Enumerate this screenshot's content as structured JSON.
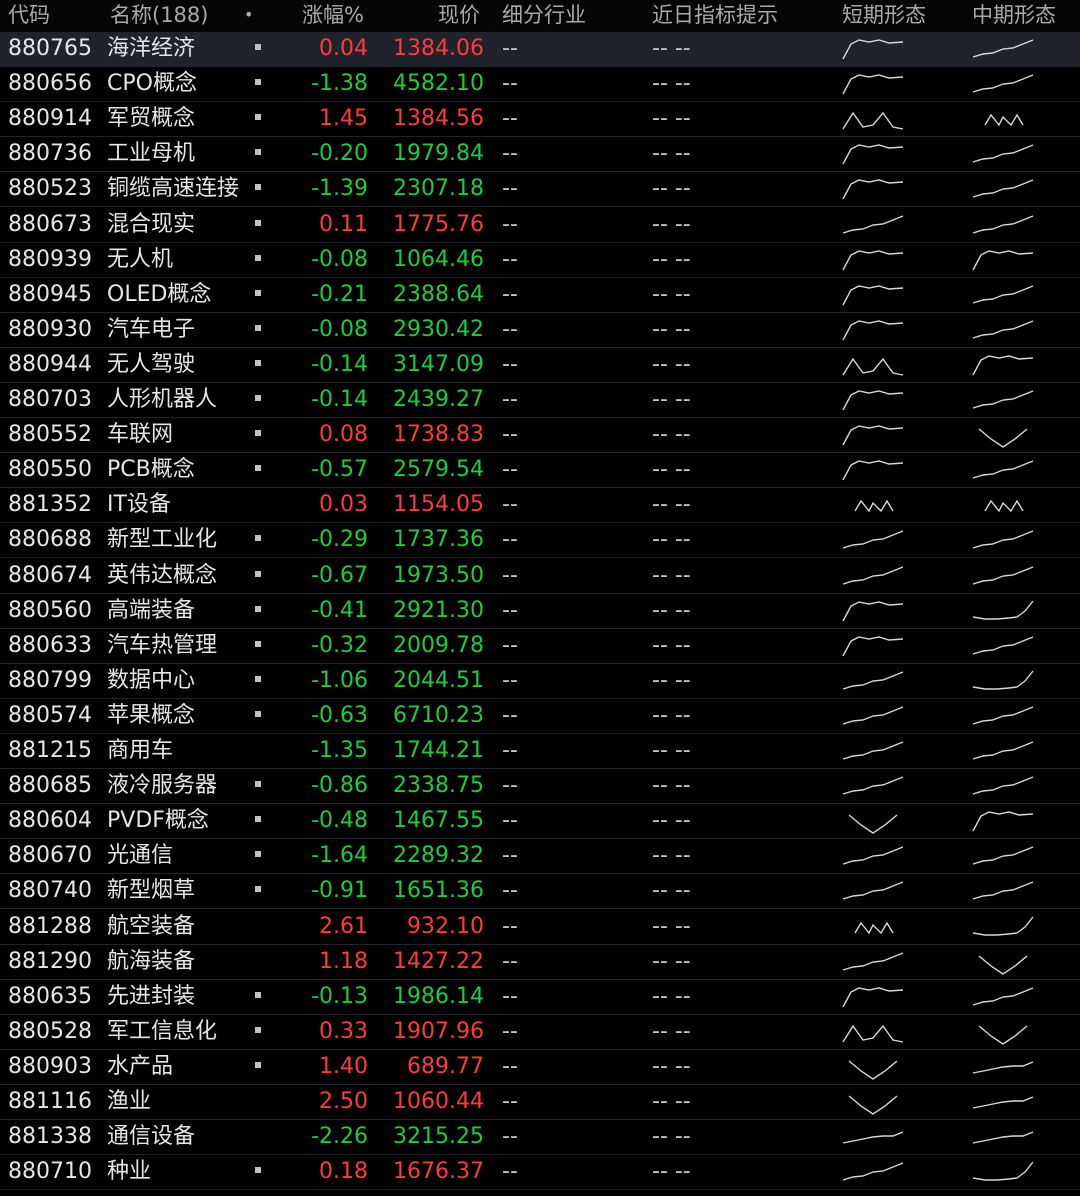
{
  "columns": {
    "code": "代码",
    "name": "名称(188)",
    "marker": "•",
    "change": "涨幅%",
    "price": "现价",
    "industry": "细分行业",
    "hint": "近日指标提示",
    "short_shape": "短期形态",
    "mid_shape": "中期形态"
  },
  "colors": {
    "up": "#ff3b3b",
    "down": "#1ccd3c",
    "selected_row": "#20232b"
  },
  "rows": [
    {
      "code": "880765",
      "name": "海洋经济",
      "dot": true,
      "chg": "0.04",
      "price": "1384.06",
      "industry": "--",
      "hint": "-- --",
      "short": "peak",
      "mid": "rise"
    },
    {
      "code": "880656",
      "name": "CPO概念",
      "dot": true,
      "chg": "-1.38",
      "price": "4582.10",
      "industry": "--",
      "hint": "-- --",
      "short": "peak",
      "mid": "rise"
    },
    {
      "code": "880914",
      "name": "军贸概念",
      "dot": true,
      "chg": "1.45",
      "price": "1384.56",
      "industry": "--",
      "hint": "-- --",
      "short": "m",
      "mid": "na"
    },
    {
      "code": "880736",
      "name": "工业母机",
      "dot": true,
      "chg": "-0.20",
      "price": "1979.84",
      "industry": "--",
      "hint": "-- --",
      "short": "peak",
      "mid": "rise"
    },
    {
      "code": "880523",
      "name": "铜缆高速连接",
      "dot": true,
      "chg": "-1.39",
      "price": "2307.18",
      "industry": "--",
      "hint": "-- --",
      "short": "peak",
      "mid": "rise"
    },
    {
      "code": "880673",
      "name": "混合现实",
      "dot": true,
      "chg": "0.11",
      "price": "1775.76",
      "industry": "--",
      "hint": "-- --",
      "short": "rise",
      "mid": "rise"
    },
    {
      "code": "880939",
      "name": "无人机",
      "dot": true,
      "chg": "-0.08",
      "price": "1064.46",
      "industry": "--",
      "hint": "-- --",
      "short": "peak",
      "mid": "peak"
    },
    {
      "code": "880945",
      "name": "OLED概念",
      "dot": true,
      "chg": "-0.21",
      "price": "2388.64",
      "industry": "--",
      "hint": "-- --",
      "short": "peak",
      "mid": "rise"
    },
    {
      "code": "880930",
      "name": "汽车电子",
      "dot": true,
      "chg": "-0.08",
      "price": "2930.42",
      "industry": "--",
      "hint": "-- --",
      "short": "peak",
      "mid": "rise"
    },
    {
      "code": "880944",
      "name": "无人驾驶",
      "dot": true,
      "chg": "-0.14",
      "price": "3147.09",
      "industry": "--",
      "hint": "-- --",
      "short": "m",
      "mid": "peak"
    },
    {
      "code": "880703",
      "name": "人形机器人",
      "dot": true,
      "chg": "-0.14",
      "price": "2439.27",
      "industry": "--",
      "hint": "-- --",
      "short": "peak",
      "mid": "rise"
    },
    {
      "code": "880552",
      "name": "车联网",
      "dot": true,
      "chg": "0.08",
      "price": "1738.83",
      "industry": "--",
      "hint": "-- --",
      "short": "peak",
      "mid": "v"
    },
    {
      "code": "880550",
      "name": "PCB概念",
      "dot": true,
      "chg": "-0.57",
      "price": "2579.54",
      "industry": "--",
      "hint": "-- --",
      "short": "peak",
      "mid": "rise"
    },
    {
      "code": "881352",
      "name": "IT设备",
      "dot": false,
      "chg": "0.03",
      "price": "1154.05",
      "industry": "--",
      "hint": "-- --",
      "short": "na",
      "mid": "na"
    },
    {
      "code": "880688",
      "name": "新型工业化",
      "dot": true,
      "chg": "-0.29",
      "price": "1737.36",
      "industry": "--",
      "hint": "-- --",
      "short": "rise",
      "mid": "rise"
    },
    {
      "code": "880674",
      "name": "英伟达概念",
      "dot": true,
      "chg": "-0.67",
      "price": "1973.50",
      "industry": "--",
      "hint": "-- --",
      "short": "rise",
      "mid": "rise"
    },
    {
      "code": "880560",
      "name": "高端装备",
      "dot": true,
      "chg": "-0.41",
      "price": "2921.30",
      "industry": "--",
      "hint": "-- --",
      "short": "peak",
      "mid": "hook"
    },
    {
      "code": "880633",
      "name": "汽车热管理",
      "dot": true,
      "chg": "-0.32",
      "price": "2009.78",
      "industry": "--",
      "hint": "-- --",
      "short": "peak",
      "mid": "rise"
    },
    {
      "code": "880799",
      "name": "数据中心",
      "dot": true,
      "chg": "-1.06",
      "price": "2044.51",
      "industry": "--",
      "hint": "-- --",
      "short": "rise",
      "mid": "hook"
    },
    {
      "code": "880574",
      "name": "苹果概念",
      "dot": true,
      "chg": "-0.63",
      "price": "6710.23",
      "industry": "--",
      "hint": "-- --",
      "short": "rise",
      "mid": "rise"
    },
    {
      "code": "881215",
      "name": "商用车",
      "dot": false,
      "chg": "-1.35",
      "price": "1744.21",
      "industry": "--",
      "hint": "-- --",
      "short": "rise",
      "mid": "rise"
    },
    {
      "code": "880685",
      "name": "液冷服务器",
      "dot": true,
      "chg": "-0.86",
      "price": "2338.75",
      "industry": "--",
      "hint": "-- --",
      "short": "rise",
      "mid": "rise"
    },
    {
      "code": "880604",
      "name": "PVDF概念",
      "dot": true,
      "chg": "-0.48",
      "price": "1467.55",
      "industry": "--",
      "hint": "-- --",
      "short": "v",
      "mid": "peak"
    },
    {
      "code": "880670",
      "name": "光通信",
      "dot": true,
      "chg": "-1.64",
      "price": "2289.32",
      "industry": "--",
      "hint": "-- --",
      "short": "rise",
      "mid": "rise"
    },
    {
      "code": "880740",
      "name": "新型烟草",
      "dot": true,
      "chg": "-0.91",
      "price": "1651.36",
      "industry": "--",
      "hint": "-- --",
      "short": "rise",
      "mid": "rise"
    },
    {
      "code": "881288",
      "name": "航空装备",
      "dot": false,
      "chg": "2.61",
      "price": "932.10",
      "industry": "--",
      "hint": "-- --",
      "short": "na",
      "mid": "hook"
    },
    {
      "code": "881290",
      "name": "航海装备",
      "dot": false,
      "chg": "1.18",
      "price": "1427.22",
      "industry": "--",
      "hint": "-- --",
      "short": "rise",
      "mid": "v"
    },
    {
      "code": "880635",
      "name": "先进封装",
      "dot": true,
      "chg": "-0.13",
      "price": "1986.14",
      "industry": "--",
      "hint": "-- --",
      "short": "peak",
      "mid": "rise"
    },
    {
      "code": "880528",
      "name": "军工信息化",
      "dot": true,
      "chg": "0.33",
      "price": "1907.96",
      "industry": "--",
      "hint": "-- --",
      "short": "m",
      "mid": "v"
    },
    {
      "code": "880903",
      "name": "水产品",
      "dot": true,
      "chg": "1.40",
      "price": "689.77",
      "industry": "--",
      "hint": "-- --",
      "short": "v",
      "mid": "rise2"
    },
    {
      "code": "881116",
      "name": "渔业",
      "dot": false,
      "chg": "2.50",
      "price": "1060.44",
      "industry": "--",
      "hint": "-- --",
      "short": "v",
      "mid": "rise2"
    },
    {
      "code": "881338",
      "name": "通信设备",
      "dot": false,
      "chg": "-2.26",
      "price": "3215.25",
      "industry": "--",
      "hint": "-- --",
      "short": "rise2",
      "mid": "rise2"
    },
    {
      "code": "880710",
      "name": "种业",
      "dot": true,
      "chg": "0.18",
      "price": "1676.37",
      "industry": "--",
      "hint": "-- --",
      "short": "rise",
      "mid": "hook"
    }
  ]
}
